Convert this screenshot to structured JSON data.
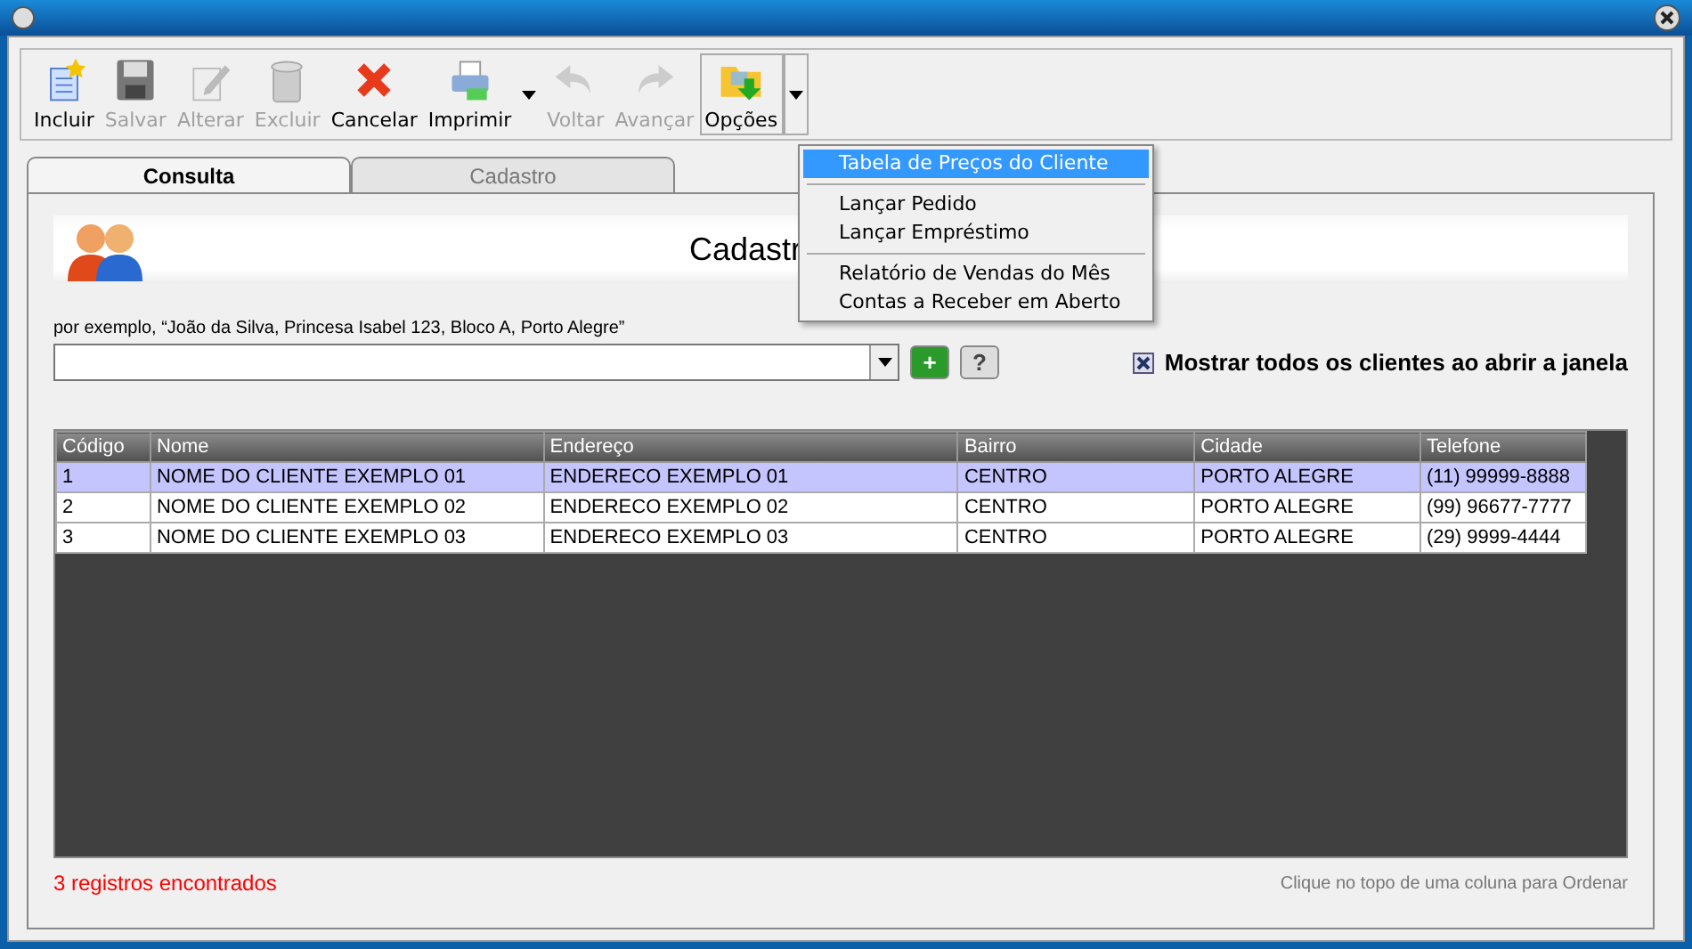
{
  "toolbar": [
    {
      "label": "Incluir",
      "disabled": false
    },
    {
      "label": "Salvar",
      "disabled": true
    },
    {
      "label": "Alterar",
      "disabled": true
    },
    {
      "label": "Excluir",
      "disabled": true
    },
    {
      "label": "Cancelar",
      "disabled": false
    },
    {
      "label": "Imprimir",
      "disabled": false,
      "dropdown": true
    },
    {
      "label": "Voltar",
      "disabled": true
    },
    {
      "label": "Avançar",
      "disabled": true
    },
    {
      "label": "Opções",
      "disabled": false,
      "dropdown": true
    }
  ],
  "options_menu": {
    "groups": [
      [
        {
          "label": "Tabela de Preços do Cliente",
          "selected": true
        }
      ],
      [
        {
          "label": "Lançar Pedido",
          "selected": false
        },
        {
          "label": "Lançar Empréstimo",
          "selected": false
        }
      ],
      [
        {
          "label": "Relatório de Vendas do Mês",
          "selected": false
        },
        {
          "label": "Contas a Receber em Aberto",
          "selected": false
        }
      ]
    ]
  },
  "tabs": [
    {
      "label": "Consulta",
      "selected": true
    },
    {
      "label": "Cadastro",
      "selected": false
    }
  ],
  "header": {
    "title": "Cadastr"
  },
  "search": {
    "hint": "por exemplo, “João da Silva, Princesa Isabel 123, Bloco A, Porto Alegre”",
    "add_button": "+",
    "help_button": "?"
  },
  "show_all": {
    "label": "Mostrar todos os clientes ao abrir a janela",
    "checked": true
  },
  "table": {
    "columns": [
      "Código",
      "Nome",
      "Endereço",
      "Bairro",
      "Cidade",
      "Telefone"
    ],
    "rows": [
      {
        "cells": [
          "1",
          "NOME DO CLIENTE EXEMPLO 01",
          "ENDERECO EXEMPLO 01",
          "CENTRO",
          "PORTO ALEGRE",
          "(11) 99999-8888"
        ],
        "selected": true
      },
      {
        "cells": [
          "2",
          "NOME DO CLIENTE EXEMPLO 02",
          "ENDERECO EXEMPLO 02",
          "CENTRO",
          "PORTO ALEGRE",
          "(99) 96677-7777"
        ],
        "selected": false
      },
      {
        "cells": [
          "3",
          "NOME DO CLIENTE EXEMPLO 03",
          "ENDERECO EXEMPLO 03",
          "CENTRO",
          "PORTO ALEGRE",
          "(29) 9999-4444"
        ],
        "selected": false
      }
    ]
  },
  "status": {
    "count": "3 registros encontrados",
    "hint": "Clique no topo de uma coluna para Ordenar"
  }
}
